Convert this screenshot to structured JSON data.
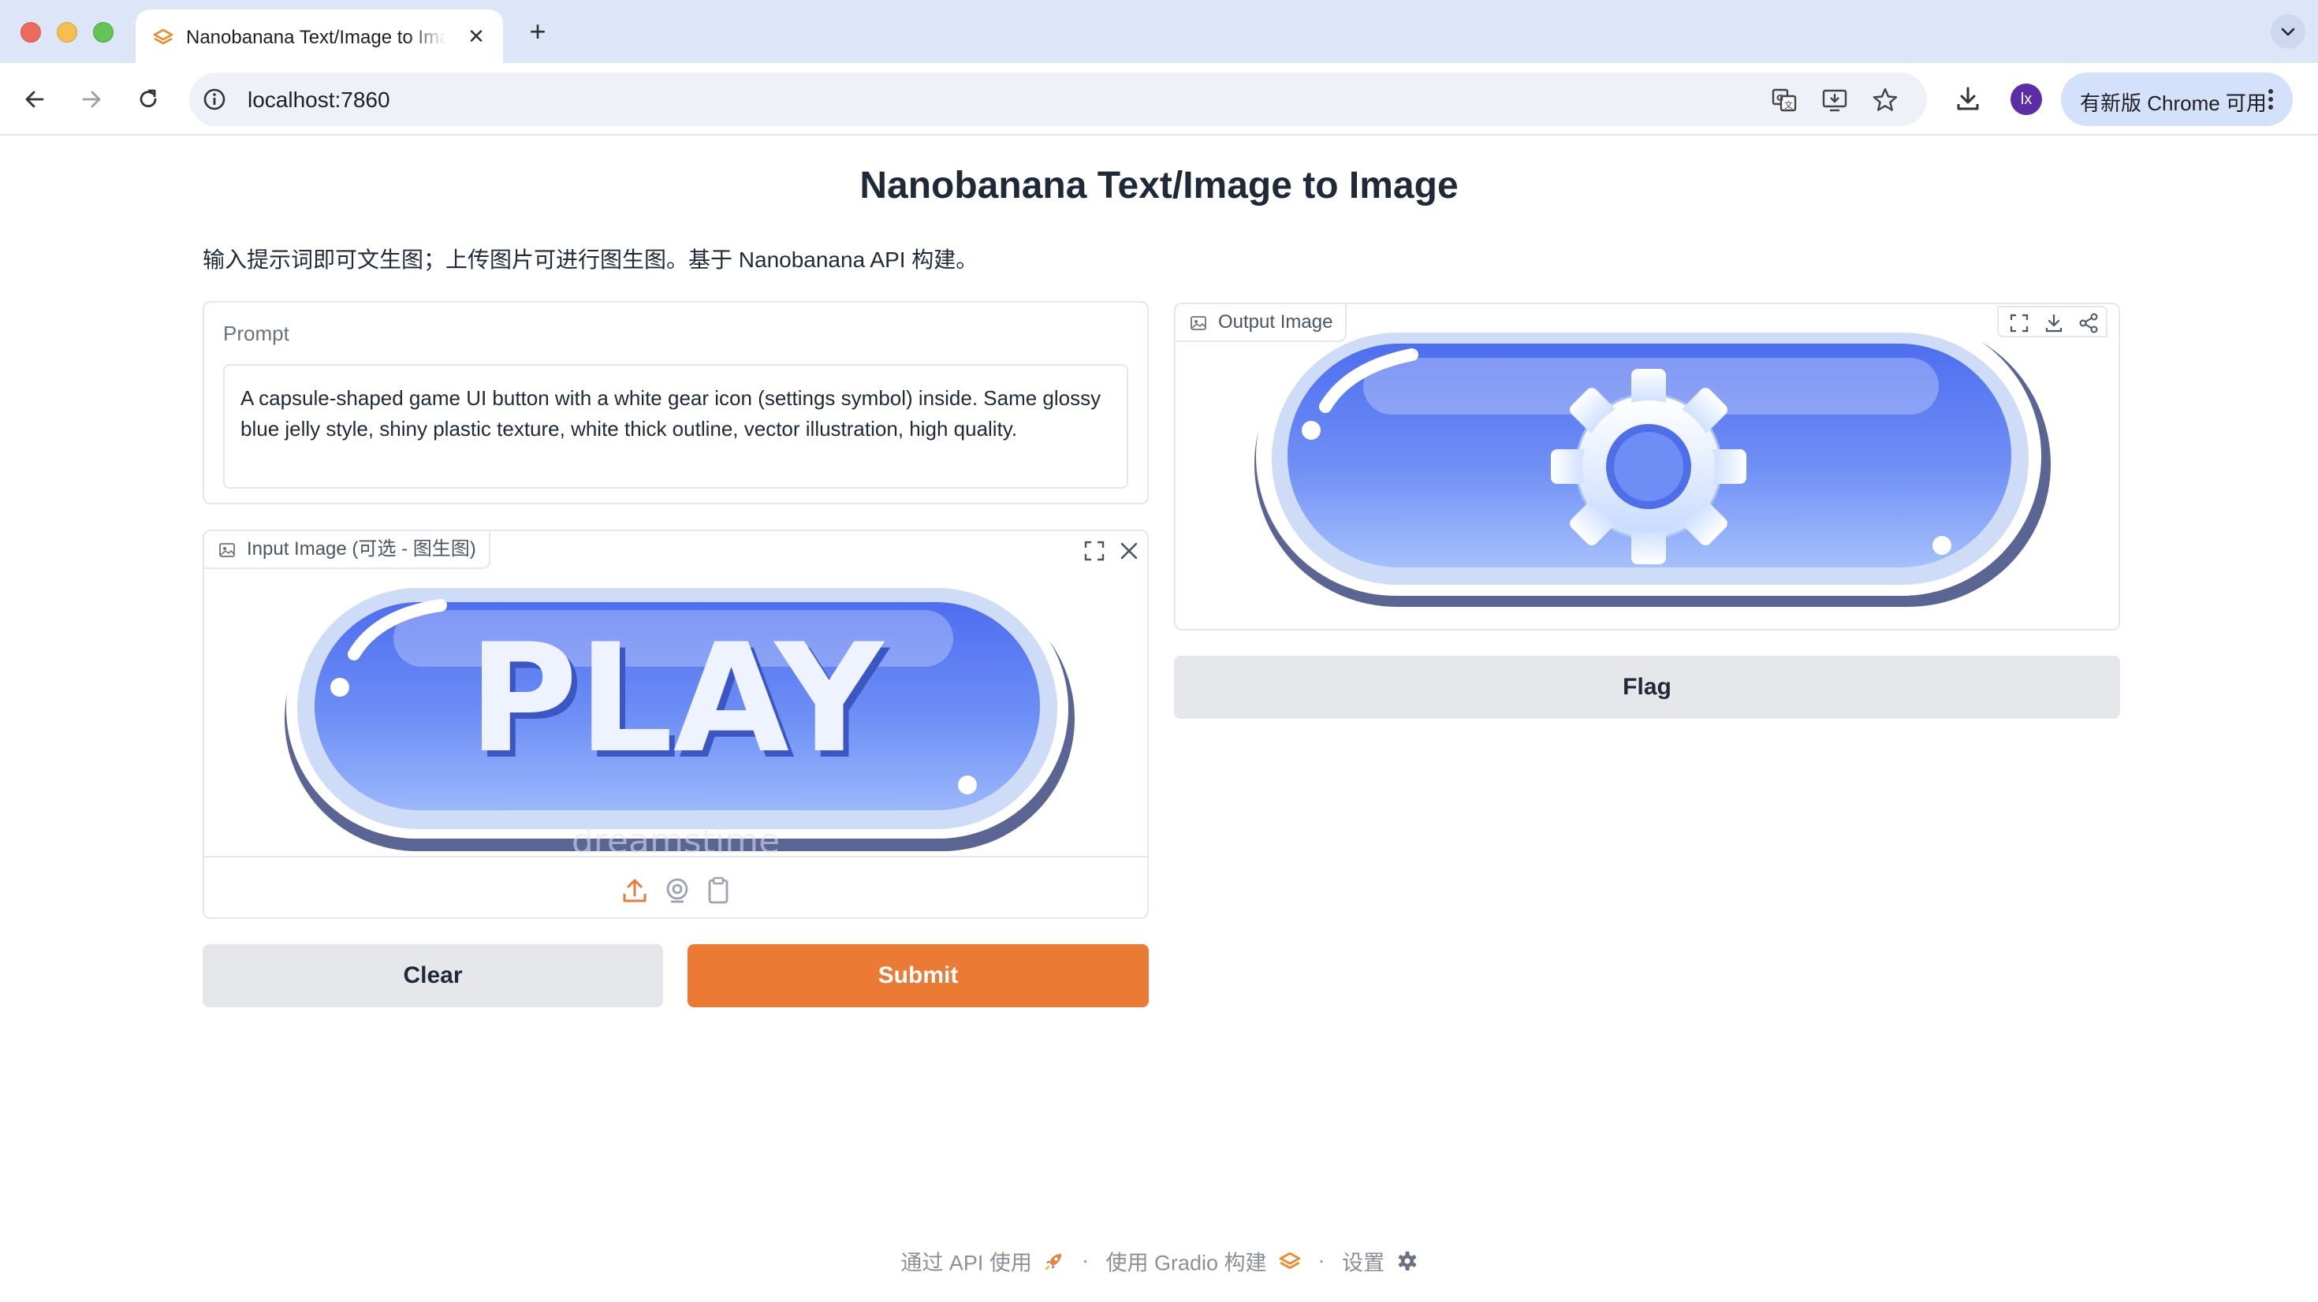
{
  "browser": {
    "tab_title": "Nanobanana Text/Image to Image",
    "tab_close": "✕",
    "new_tab": "+",
    "url": "localhost:7860",
    "profile_initial": "lx",
    "update_label": "有新版 Chrome 可用"
  },
  "page": {
    "title": "Nanobanana Text/Image to Image",
    "description": "输入提示词即可文生图；上传图片可进行图生图。基于 Nanobanana API 构建。"
  },
  "prompt": {
    "label": "Prompt",
    "value": "A capsule-shaped game UI button with a white gear icon (settings symbol) inside. Same glossy blue jelly style, shiny plastic texture, white thick outline, vector illustration, high quality."
  },
  "input_image": {
    "label": "Input Image (可选 - 图生图)",
    "image_text": "PLAY",
    "watermark": "dreamstime"
  },
  "output_image": {
    "label": "Output Image"
  },
  "buttons": {
    "clear": "Clear",
    "submit": "Submit",
    "flag": "Flag"
  },
  "footer": {
    "api_link": "通过 API 使用",
    "gradio_link": "使用 Gradio 构建",
    "settings_link": "设置",
    "separator": "·"
  },
  "colors": {
    "accent": "#ea7a34",
    "secondary_button": "#e5e7eb",
    "jelly_blue": "#5a7ff0",
    "jelly_outline": "#5a6594"
  },
  "icons": [
    "translate-icon",
    "install-app-icon",
    "bookmark-star-icon",
    "download-icon",
    "upload-icon",
    "webcam-icon",
    "clipboard-icon",
    "fullscreen-icon",
    "close-icon",
    "share-icon",
    "rocket-icon",
    "gradio-logo-icon",
    "gear-icon"
  ]
}
